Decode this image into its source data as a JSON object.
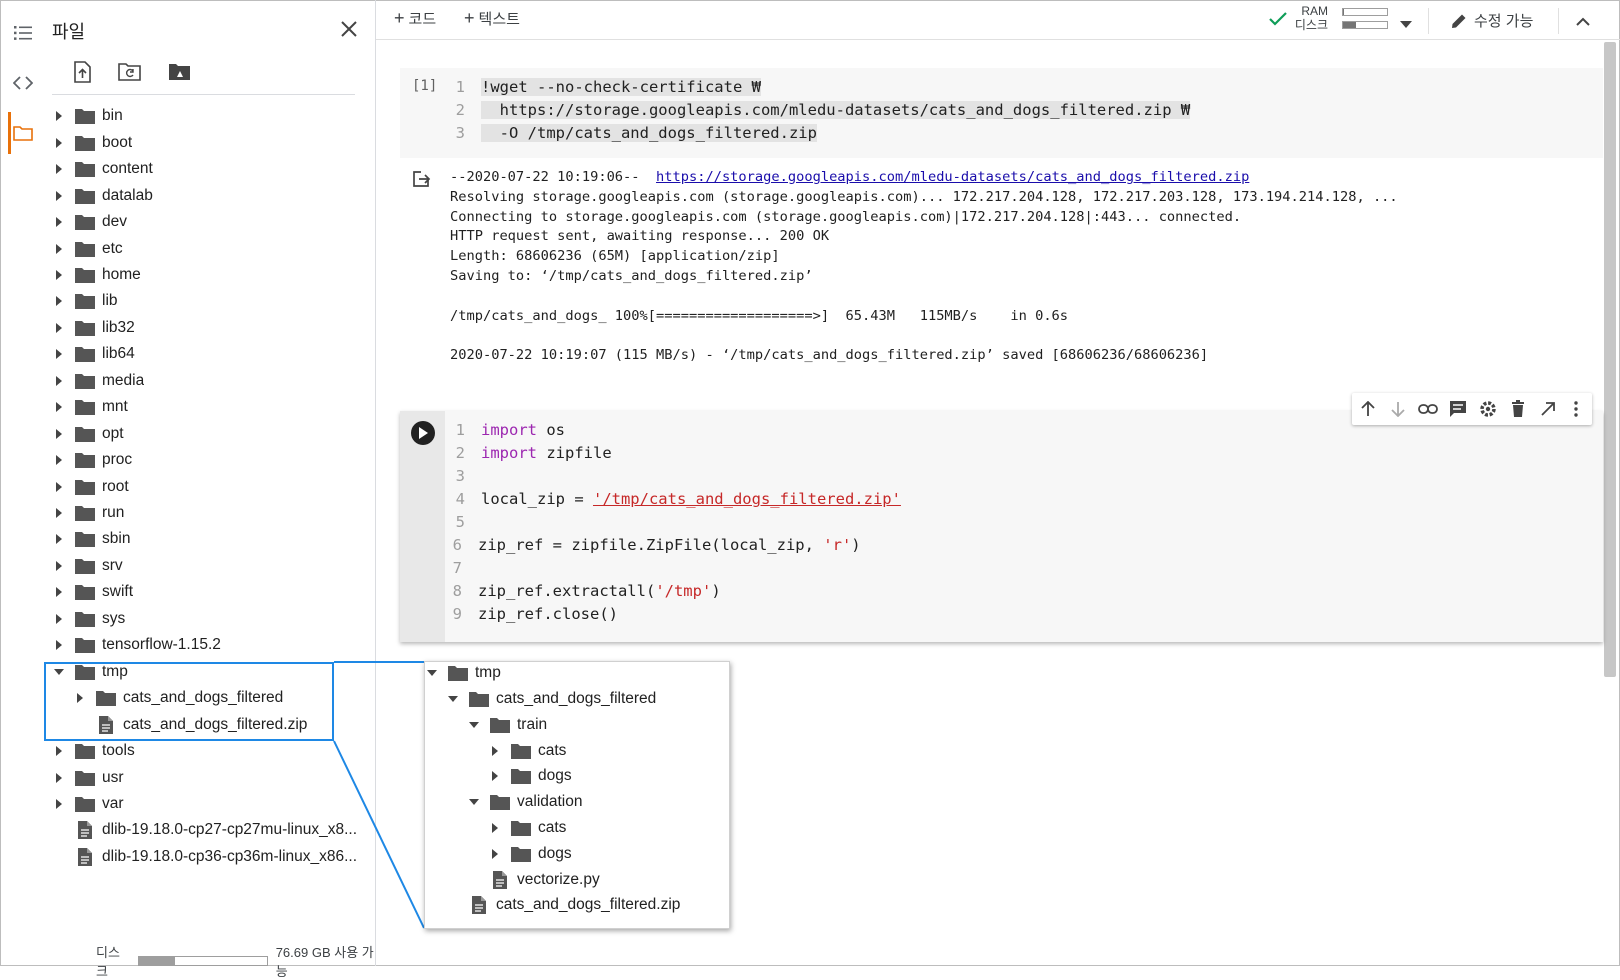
{
  "files_panel": {
    "title": "파일",
    "tree": [
      {
        "name": "bin",
        "type": "folder",
        "depth": 0,
        "state": "collapsed"
      },
      {
        "name": "boot",
        "type": "folder",
        "depth": 0,
        "state": "collapsed"
      },
      {
        "name": "content",
        "type": "folder",
        "depth": 0,
        "state": "collapsed"
      },
      {
        "name": "datalab",
        "type": "folder",
        "depth": 0,
        "state": "collapsed"
      },
      {
        "name": "dev",
        "type": "folder",
        "depth": 0,
        "state": "collapsed"
      },
      {
        "name": "etc",
        "type": "folder",
        "depth": 0,
        "state": "collapsed"
      },
      {
        "name": "home",
        "type": "folder",
        "depth": 0,
        "state": "collapsed"
      },
      {
        "name": "lib",
        "type": "folder",
        "depth": 0,
        "state": "collapsed"
      },
      {
        "name": "lib32",
        "type": "folder",
        "depth": 0,
        "state": "collapsed"
      },
      {
        "name": "lib64",
        "type": "folder",
        "depth": 0,
        "state": "collapsed"
      },
      {
        "name": "media",
        "type": "folder",
        "depth": 0,
        "state": "collapsed"
      },
      {
        "name": "mnt",
        "type": "folder",
        "depth": 0,
        "state": "collapsed"
      },
      {
        "name": "opt",
        "type": "folder",
        "depth": 0,
        "state": "collapsed"
      },
      {
        "name": "proc",
        "type": "folder",
        "depth": 0,
        "state": "collapsed"
      },
      {
        "name": "root",
        "type": "folder",
        "depth": 0,
        "state": "collapsed"
      },
      {
        "name": "run",
        "type": "folder",
        "depth": 0,
        "state": "collapsed"
      },
      {
        "name": "sbin",
        "type": "folder",
        "depth": 0,
        "state": "collapsed"
      },
      {
        "name": "srv",
        "type": "folder",
        "depth": 0,
        "state": "collapsed"
      },
      {
        "name": "swift",
        "type": "folder",
        "depth": 0,
        "state": "collapsed"
      },
      {
        "name": "sys",
        "type": "folder",
        "depth": 0,
        "state": "collapsed"
      },
      {
        "name": "tensorflow-1.15.2",
        "type": "folder",
        "depth": 0,
        "state": "collapsed"
      },
      {
        "name": "tmp",
        "type": "folder",
        "depth": 0,
        "state": "expanded"
      },
      {
        "name": "cats_and_dogs_filtered",
        "type": "folder",
        "depth": 1,
        "state": "collapsed"
      },
      {
        "name": "cats_and_dogs_filtered.zip",
        "type": "file",
        "depth": 1,
        "state": "none"
      },
      {
        "name": "tools",
        "type": "folder",
        "depth": 0,
        "state": "collapsed"
      },
      {
        "name": "usr",
        "type": "folder",
        "depth": 0,
        "state": "collapsed"
      },
      {
        "name": "var",
        "type": "folder",
        "depth": 0,
        "state": "collapsed"
      },
      {
        "name": "dlib-19.18.0-cp27-cp27mu-linux_x8...",
        "type": "file",
        "depth": 0,
        "state": "none"
      },
      {
        "name": "dlib-19.18.0-cp36-cp36m-linux_x86...",
        "type": "file",
        "depth": 0,
        "state": "none"
      }
    ],
    "disk": {
      "label": "디스크",
      "value_text": "76.69 GB 사용 가능",
      "fill_fraction": 0.28
    }
  },
  "toolbar": {
    "add_code": "코드",
    "add_text": "텍스트",
    "ram_label": "RAM",
    "disk_label": "디스크",
    "ram_fraction": 0.03,
    "disk_fraction": 0.3,
    "edit_label": "수정 가능"
  },
  "cell1": {
    "exec_count": "[1]",
    "line_numbers": [
      "1",
      "2",
      "3"
    ],
    "lines": [
      "!wget --no-check-certificate ₩",
      "  https://storage.googleapis.com/mledu-datasets/cats_and_dogs_filtered.zip ₩",
      "  -O /tmp/cats_and_dogs_filtered.zip"
    ],
    "output": {
      "line1_prefix": "--2020-07-22 10:19:06--  ",
      "line1_link": "https://storage.googleapis.com/mledu-datasets/cats_and_dogs_filtered.zip",
      "rest": "Resolving storage.googleapis.com (storage.googleapis.com)... 172.217.204.128, 172.217.203.128, 173.194.214.128, ...\nConnecting to storage.googleapis.com (storage.googleapis.com)|172.217.204.128|:443... connected.\nHTTP request sent, awaiting response... 200 OK\nLength: 68606236 (65M) [application/zip]\nSaving to: ‘/tmp/cats_and_dogs_filtered.zip’\n\n/tmp/cats_and_dogs_ 100%[===================>]  65.43M   115MB/s    in 0.6s\n\n2020-07-22 10:19:07 (115 MB/s) - ‘/tmp/cats_and_dogs_filtered.zip’ saved [68606236/68606236]"
    }
  },
  "cell2": {
    "line_numbers": [
      "1",
      "2",
      "3",
      "4",
      "5",
      "6",
      "7",
      "8",
      "9"
    ],
    "code": {
      "l1_kw": "import",
      "l1_rest": " os",
      "l2_kw": "import",
      "l2_rest": " zipfile",
      "l4_a": "local_zip = ",
      "l4_str": "'/tmp/cats_and_dogs_filtered.zip'",
      "l6_a": "zip_ref = zipfile.ZipFile(local_zip, ",
      "l6_str": "'r'",
      "l6_b": ")",
      "l8_a": "zip_ref.extractall(",
      "l8_str": "'/tmp'",
      "l8_b": ")",
      "l9": "zip_ref.close()"
    }
  },
  "zoom_tree": [
    {
      "name": "tmp",
      "type": "folder",
      "depth": 0,
      "state": "expanded"
    },
    {
      "name": "cats_and_dogs_filtered",
      "type": "folder",
      "depth": 1,
      "state": "expanded"
    },
    {
      "name": "train",
      "type": "folder",
      "depth": 2,
      "state": "expanded"
    },
    {
      "name": "cats",
      "type": "folder",
      "depth": 3,
      "state": "collapsed"
    },
    {
      "name": "dogs",
      "type": "folder",
      "depth": 3,
      "state": "collapsed"
    },
    {
      "name": "validation",
      "type": "folder",
      "depth": 2,
      "state": "expanded"
    },
    {
      "name": "cats",
      "type": "folder",
      "depth": 3,
      "state": "collapsed"
    },
    {
      "name": "dogs",
      "type": "folder",
      "depth": 3,
      "state": "collapsed"
    },
    {
      "name": "vectorize.py",
      "type": "file",
      "depth": 2,
      "state": "none"
    },
    {
      "name": "cats_and_dogs_filtered.zip",
      "type": "file",
      "depth": 1,
      "state": "none"
    }
  ],
  "colors": {
    "accent_orange": "#e8710a",
    "highlight_blue": "#1e88e5",
    "check_green": "#0f9d58",
    "keyword": "#9c27b0",
    "string": "#c62828",
    "link": "#1a0dab"
  }
}
